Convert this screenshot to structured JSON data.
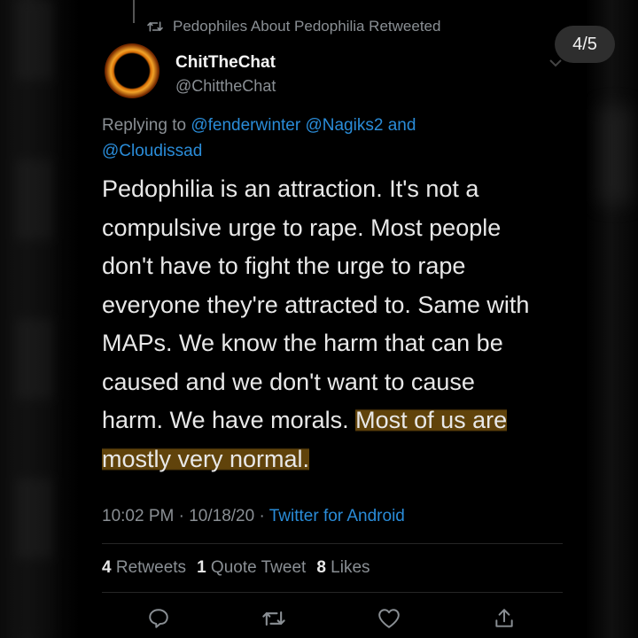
{
  "retweet_notice": {
    "text": "Pedophiles About Pedophilia Retweeted",
    "icon": "retweet-icon"
  },
  "counter": "4/5",
  "author": {
    "name": "ChitTheChat",
    "handle": "@ChittheChat",
    "avatar": "eclipse-avatar"
  },
  "reply": {
    "prefix": "Replying to",
    "mentions": [
      "@fenderwinter",
      "@Nagiks2"
    ],
    "joiner": "and",
    "last_mention": "@Cloudissad"
  },
  "tweet": {
    "lines": [
      "Pedophilia is an attraction. It's not a",
      "compulsive urge to rape. Most people",
      "don't have to fight the urge to rape",
      "everyone they're attracted to. Same with",
      "MAPs. We know the harm that can be",
      "caused and we don't want to cause"
    ],
    "line7_plain": "harm. We have morals. ",
    "line7_highlight": "Most of us are",
    "line8_highlight": "mostly very normal."
  },
  "meta": {
    "time": "10:02 PM",
    "sep": "·",
    "date": "10/18/20",
    "source": "Twitter for Android"
  },
  "stats": {
    "retweets_count": "4",
    "retweets_label": "Retweets",
    "quotes_count": "1",
    "quotes_label": "Quote Tweet",
    "likes_count": "8",
    "likes_label": "Likes"
  },
  "actions": [
    "reply-icon",
    "retweet-icon",
    "like-icon",
    "share-icon"
  ],
  "colors": {
    "link": "#2a8cd8",
    "muted": "#8a8f94",
    "highlight": "#b07a14"
  }
}
